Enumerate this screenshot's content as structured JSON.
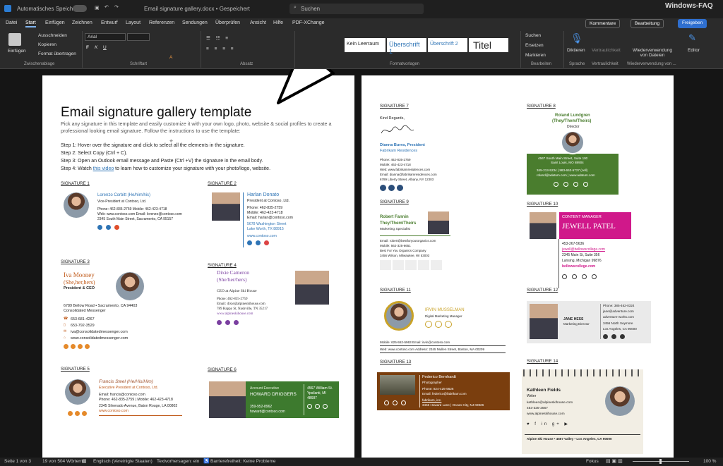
{
  "titlebar": {
    "autosave": "Automatisches Speichern",
    "filename": "Email signature gallery.docx • Gespeichert",
    "search": "Suchen",
    "brand": "Windows-FAQ"
  },
  "tabs": [
    "Datei",
    "Start",
    "Einfügen",
    "Zeichnen",
    "Entwurf",
    "Layout",
    "Referenzen",
    "Sendungen",
    "Überprüfen",
    "Ansicht",
    "Hilfe",
    "PDF-XChange"
  ],
  "buttons": {
    "comments": "Kommentare",
    "editing": "Bearbeitung",
    "share": "Freigeben"
  },
  "clipboard": {
    "paste": "Einfügen",
    "cut": "Ausschneiden",
    "copy": "Kopieren",
    "format": "Format übertragen",
    "label": "Zwischenablage"
  },
  "font": {
    "name": "Arial",
    "label": "Schriftart"
  },
  "paragraph": {
    "label": "Absatz"
  },
  "styles": {
    "items": [
      "Kein Leerraum",
      "Überschrift 1",
      "Überschrift 2",
      "Titel"
    ],
    "label": "Formatvorlagen"
  },
  "editing": {
    "find": "Suchen",
    "replace": "Ersetzen",
    "select": "Markieren",
    "label": "Bearbeiten"
  },
  "voice": {
    "dictate": "Diktieren",
    "label": "Sprache"
  },
  "sensitivity": {
    "btn": "Vertraulichkeit",
    "label": "Vertraulichkeit"
  },
  "reuse": {
    "btn": "Wiederverwendung von Dateien",
    "label": "Wiederverwendung von ..."
  },
  "editor": {
    "btn": "Editor"
  },
  "page1": {
    "title": "Email signature gallery template",
    "intro": "Pick any signature in this template and easily customize it with your own logo, photo, website & social profiles to create a professional looking email signature. Follow the instructions to use the template:",
    "step1": "Step 1: Hover over the signature and click     to select all the elements in the signature.",
    "step2": "Step 2: Select Copy (Ctrl + C).",
    "step3": "Step 3: Open an Outlook email message and Paste (Ctrl +V) the signature in the email body.",
    "step4a": "Step 4: Watch ",
    "step4link": "this video",
    "step4b": " to learn how to customize your signature with your photo/logo, website.",
    "sig1": {
      "head": "SIGNATURE 1",
      "name": "Lorenzo Corbitt (He/him/his)",
      "role": "Vice-President at Contoso, Ltd.",
      "l1": "Phone: 462-835-2759  Mobile: 462-423-4718",
      "l2": "Web: www.contoso.com  Email: lorenzo@contoso.com",
      "l3": "2345 South Main Street, Sacramento, CA 95157"
    },
    "sig2": {
      "head": "SIGNATURE 2",
      "name": "Harlan Donato",
      "role": "President at Contoso, Ltd.",
      "l1": "Phone: 462-835-2759",
      "l2": "Mobile: 462-423-4718",
      "l3": "Email: harlan@contoso.com",
      "l4": "5678 Washington Street",
      "l5": "Lake Worth, TX 88915",
      "l6": "www.contoso.com"
    },
    "sig3": {
      "head": "SIGNATURE 3",
      "name": "Iva Mooney",
      "pron": "(She,her,hers)",
      "role": "President & CEO",
      "l1": "6789 Bellow Road • Sacramento, CA 94403",
      "l2": "Consolidated Messenger",
      "l3": "653-681-4267",
      "l4": "653-792-3529",
      "l5": "iva@consolidatedmessenger.com",
      "l6": "www.consolidatedmessenger.com"
    },
    "sig4": {
      "head": "SIGNATURE 4",
      "name": "Dixie Cameron",
      "pron": "(She/her/hers)",
      "role": "CEO at Alpine Ski House",
      "l1": "Phone: 462-835-2759",
      "l2": "Email: dixie@alpineskihouse.com",
      "l3": "789 Happy St, Nashville, TN 35217",
      "l4": "www.alpineskihouse.com"
    },
    "sig5": {
      "head": "SIGNATURE 5",
      "name": "Francis Steel (He/His/Him)",
      "role": "Executive President at Contoso, Ltd.",
      "l1": "Email: francis@contoso.com",
      "l2": "Phone: 462-835-2759  |  Mobile: 462-423-4718",
      "l3": "2345 Silverado Avenue, Baton Rouge, LA 00802",
      "l4": "www.contoso.com"
    },
    "sig6": {
      "head": "SIGNATURE 6",
      "role": "Account Executive",
      "name": "HOWARD DRIGGERS",
      "l1": "359-952-8962",
      "l2": "howard@contoso.com",
      "a1": "4567 William St.",
      "a2": "Ypsilanti, MI",
      "a3": "48687"
    }
  },
  "page2": {
    "sig7": {
      "head": "SIGNATURE 7",
      "greet": "Kind Regards,",
      "name": "Dianna Burns, President",
      "co": "Fabrikam Residences",
      "l1": "Phone: 462-835-2759",
      "l2": "Mobile: 462-423-4718",
      "l3": "Web: www.fabrikamresidences.com",
      "l4": "Email: dianna@fabrikamresidences.com",
      "l5": "6789 Liberty Street, Albany, NY 12303"
    },
    "sig8": {
      "head": "SIGNATURE 8",
      "name": "Roland Lundgren",
      "pron": "(They/Them/Theirs)",
      "role": "Director",
      "l1": "4567 South Main Street, Suite 100",
      "l2": "Saint Louis, MO 88904",
      "l3": "345-213-5234  |  983-653-5727 (cell)",
      "l4": "roland@adatum.com  |  www.adatum.com"
    },
    "sig9": {
      "head": "SIGNATURE 9",
      "name": "Robert Fannin",
      "pron": "They/Them/Theirs",
      "role": "Marketing Specialist",
      "l1": "Email: robert@bestforyourorganics.com",
      "l2": "Mobile: 562-325-6651",
      "l3": "Best For You Organics Company",
      "l4": "3456 Wilson, Milwaukee, WI 53003"
    },
    "sig10": {
      "head": "SIGNATURE 10",
      "role": "CONTENT MANAGER",
      "name": "JEWELL PATEL",
      "l1": "453-267-5636",
      "l2": "jewell@bellowscollege.com",
      "l3": "2345 Main St, Suite 356",
      "l4": "Lansing, Michigan 99876",
      "l5": "bellowscollege.com"
    },
    "sig11": {
      "head": "SIGNATURE 11",
      "name": "IRVIN MUSSELMAN",
      "role": "Digital Marketing Manager",
      "l1": "Mobile: 625-552-5963  Email: irvin@contoso.com",
      "l2": "Web: www.contoso.com  Address: 2345 Mullen Street, Boston, MA 00209"
    },
    "sig12": {
      "head": "SIGNATURE 12",
      "name": "JANE HESS",
      "role": "Marketing Director",
      "l1": "Phone: 385-462-0324",
      "l2": "jane@adventure.com",
      "l3": "adventure-works.com",
      "l4": "3456 North Seymore",
      "l5": "Los Angeles, CA 90000"
    },
    "sig13": {
      "head": "SIGNATURE 13",
      "name": "Federico Bernhardt",
      "role": "Photographer",
      "l1": "Phone: 824-425-5626",
      "l2": "Email: federico@fabrikam.com",
      "l3": "fabrikam, inc.",
      "l4": "3456 Howard Lane | Ocean City, NJ 02826"
    },
    "sig14": {
      "head": "SIGNATURE 14",
      "name": "Kathleen Fields",
      "role": "Writer",
      "l1": "kathleen@alpineskihouse.com",
      "l2": "453-325-2567",
      "l3": "www.alpineskihouse.com",
      "l4": "Alpine Ski House • 4567 Valley • Los Angeles, CA 90000"
    }
  },
  "status": {
    "page": "Seite 1 von 3",
    "words": "19 von 504 Wörtern",
    "lang": "Englisch (Vereinigte Staaten)",
    "predict": "Textvorhersagen: ein",
    "access": "Barrierefreiheit: Keine Probleme",
    "focus": "Fokus",
    "zoom": "100 %"
  },
  "colors": {
    "accent": "#4a90e2",
    "green": "#4a7d2e",
    "magenta": "#c2185b",
    "brown": "#7a3e0e"
  }
}
